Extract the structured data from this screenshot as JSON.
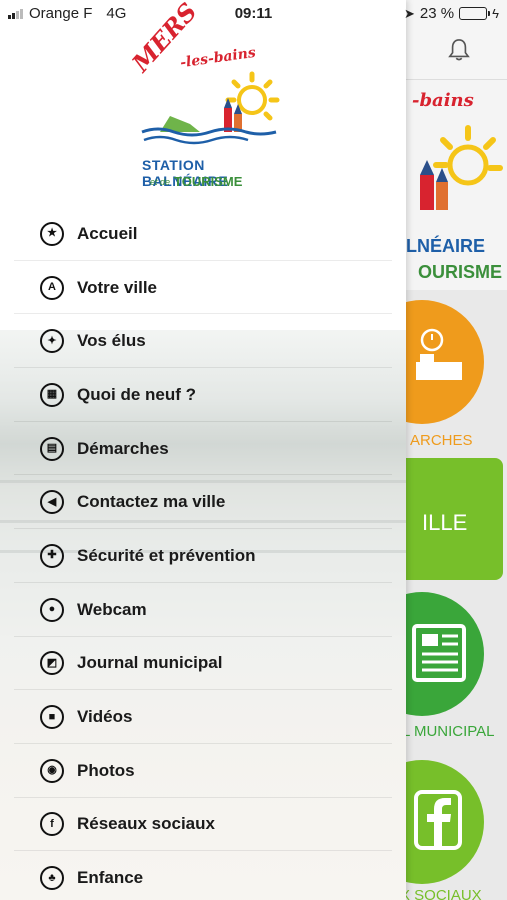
{
  "status_bar": {
    "carrier": "Orange F",
    "network": "4G",
    "time": "09:11",
    "battery_percent": "23 %",
    "battery_level": 0.23,
    "battery_color": "#f2c200"
  },
  "logo": {
    "script_top": "MERS",
    "script_suffix": "-les-bains",
    "line1": "STATION BALNÉAIRE",
    "line2_small": "et de",
    "line2": "TOURISME"
  },
  "menu": [
    {
      "label": "Accueil",
      "icon": "star-icon",
      "glyph": "★"
    },
    {
      "label": "Votre ville",
      "icon": "city-icon",
      "glyph": "A"
    },
    {
      "label": "Vos élus",
      "icon": "people-icon",
      "glyph": "✦"
    },
    {
      "label": "Quoi de neuf ?",
      "icon": "calendar-icon",
      "glyph": "▦"
    },
    {
      "label": "Démarches",
      "icon": "chat-icon",
      "glyph": "▤"
    },
    {
      "label": "Contactez ma ville",
      "icon": "megaphone-icon",
      "glyph": "◀"
    },
    {
      "label": "Sécurité et prévention",
      "icon": "plus-icon",
      "glyph": "✚"
    },
    {
      "label": "Webcam",
      "icon": "webcam-icon",
      "glyph": "●"
    },
    {
      "label": "Journal municipal",
      "icon": "journal-icon",
      "glyph": "◩"
    },
    {
      "label": "Vidéos",
      "icon": "video-icon",
      "glyph": "■"
    },
    {
      "label": "Photos",
      "icon": "camera-icon",
      "glyph": "◉"
    },
    {
      "label": "Réseaux sociaux",
      "icon": "facebook-icon",
      "glyph": "f"
    },
    {
      "label": "Enfance",
      "icon": "child-icon",
      "glyph": "♣"
    }
  ],
  "background": {
    "logo_partial_1": "-bains",
    "logo_partial_2": "LNÉAIRE",
    "logo_partial_3": "OURISME",
    "tile1_label": "ARCHES",
    "tile1_color": "#ef9b1c",
    "tile2_label": "ILLE",
    "tile2_color": "#77bf2a",
    "tile3_label": "L MUNICIPAL",
    "tile3_color": "#3aa63a",
    "tile4_label": "X SOCIAUX",
    "tile4_color": "#77bf2a"
  }
}
